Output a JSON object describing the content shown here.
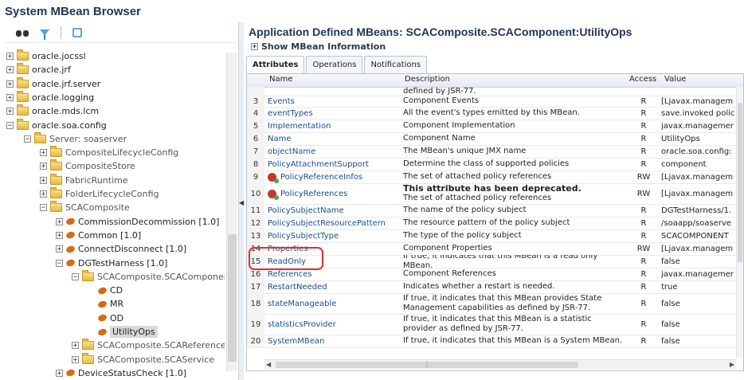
{
  "window": {
    "title": "System MBean Browser"
  },
  "toolbar": {
    "icons": [
      "binoculars-icon",
      "filter-icon",
      "refresh-icon"
    ]
  },
  "tree": {
    "items": [
      {
        "label": "oracle.jocssl",
        "expander": "+"
      },
      {
        "label": "oracle.jrf",
        "expander": "+"
      },
      {
        "label": "oracle.jrf.server",
        "expander": "+"
      },
      {
        "label": "oracle.logging",
        "expander": "+"
      },
      {
        "label": "oracle.mds.lcm",
        "expander": "+"
      },
      {
        "label": "oracle.soa.config",
        "expander": "−"
      },
      {
        "label": "Server: soaserver",
        "expander": "−"
      },
      {
        "label": "CompositeLifecycleConfig",
        "expander": "+"
      },
      {
        "label": "CompositeStore",
        "expander": "+"
      },
      {
        "label": "FabricRuntime",
        "expander": "+"
      },
      {
        "label": "FolderLifecycleConfig",
        "expander": "+"
      },
      {
        "label": "SCAComposite",
        "expander": "−"
      },
      {
        "label": "CommissionDecommission [1.0]",
        "expander": "+"
      },
      {
        "label": "Common [1.0]",
        "expander": "+"
      },
      {
        "label": "ConnectDisconnect [1.0]",
        "expander": "+"
      },
      {
        "label": "DGTestHarness [1.0]",
        "expander": "−"
      },
      {
        "label": "SCAComposite.SCAComponent",
        "expander": "−"
      },
      {
        "label": "CD",
        "expander": ""
      },
      {
        "label": "MR",
        "expander": ""
      },
      {
        "label": "OD",
        "expander": ""
      },
      {
        "label": "UtilityOps",
        "expander": ""
      },
      {
        "label": "SCAComposite.SCAReference",
        "expander": "+"
      },
      {
        "label": "SCAComposite.SCAService",
        "expander": "+"
      },
      {
        "label": "DeviceStatusCheck [1.0]",
        "expander": "+"
      }
    ]
  },
  "main": {
    "title": "Application Defined MBeans: SCAComposite.SCAComponent:UtilityOps",
    "show_info": "Show MBean Information",
    "tabs": [
      "Attributes",
      "Operations",
      "Notifications"
    ],
    "columns": {
      "name": "Name",
      "description": "Description",
      "access": "Access",
      "value": "Value"
    },
    "partial_row": {
      "description": "defined by JSR-77."
    },
    "rows": [
      {
        "num": "3",
        "name": "Events",
        "desc": "Component Events",
        "access": "R",
        "value": "[Ljavax.managem"
      },
      {
        "num": "4",
        "name": "eventTypes",
        "desc": "All the event's types emitted by this MBean.",
        "access": "R",
        "value": "save.invoked polic"
      },
      {
        "num": "5",
        "name": "Implementation",
        "desc": "Component Implementation",
        "access": "R",
        "value": "javax.managemer"
      },
      {
        "num": "6",
        "name": "Name",
        "desc": "Component Name",
        "access": "R",
        "value": "UtilityOps"
      },
      {
        "num": "7",
        "name": "objectName",
        "desc": "The MBean's unique JMX name",
        "access": "R",
        "value": "oracle.soa.config:"
      },
      {
        "num": "8",
        "name": "PolicyAttachmentSupport",
        "desc": "Determine the class of supported policies",
        "access": "R",
        "value": "component"
      },
      {
        "num": "9",
        "name": "PolicyReferenceInfos",
        "desc": "The set of attached policy references",
        "access": "RW",
        "value": "[Ljavax.managem"
      },
      {
        "num": "10",
        "name": "PolicyReferences",
        "desc_bold": "This attribute has been deprecated.",
        "desc": "The set of attached policy references",
        "access": "RW",
        "value": "[Ljavax.managem"
      },
      {
        "num": "11",
        "name": "PolicySubjectName",
        "desc": "The name of the policy subject",
        "access": "R",
        "value": "DGTestHarness/1."
      },
      {
        "num": "12",
        "name": "PolicySubjectResourcePattern",
        "desc": "The resource pattern of the policy subject",
        "access": "R",
        "value": "/soaapp/soaserve"
      },
      {
        "num": "13",
        "name": "PolicySubjectType",
        "desc": "The type of the policy subject",
        "access": "R",
        "value": "SCACOMPONENT"
      },
      {
        "num": "14",
        "name": "Properties",
        "desc": "Component Properties",
        "access": "RW",
        "value": "[Ljavax.managem"
      },
      {
        "num": "15",
        "name": "ReadOnly",
        "desc": "If true, it indicates that this MBean is a read only MBean.",
        "access": "R",
        "value": "false"
      },
      {
        "num": "16",
        "name": "References",
        "desc": "Component References",
        "access": "R",
        "value": "javax.managemer"
      },
      {
        "num": "17",
        "name": "RestartNeeded",
        "desc": "Indicates whether a restart is needed.",
        "access": "R",
        "value": "true"
      },
      {
        "num": "18",
        "name": "stateManageable",
        "desc": "If true, it indicates that this MBean provides State Management capabilities as defined by JSR-77.",
        "access": "R",
        "value": "false"
      },
      {
        "num": "19",
        "name": "statisticsProvider",
        "desc": "If true, it indicates that this MBean is a statistic provider as defined by JSR-77.",
        "access": "R",
        "value": "false"
      },
      {
        "num": "20",
        "name": "SystemMBean",
        "desc": "If true, it indicates that this MBean is a System MBean.",
        "access": "R",
        "value": "false"
      }
    ]
  },
  "colors": {
    "title": "#1f3656",
    "link": "#1a4d8f",
    "highlight": "#e2302d"
  }
}
